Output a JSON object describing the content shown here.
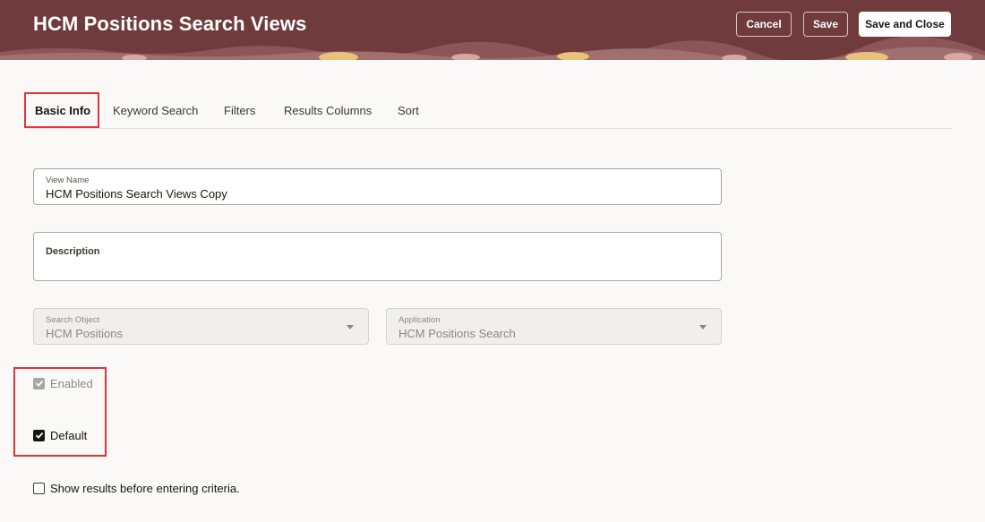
{
  "header": {
    "title": "HCM Positions Search Views",
    "cancel_label": "Cancel",
    "save_label": "Save",
    "save_close_label": "Save and Close"
  },
  "tabs": [
    {
      "label": "Basic Info",
      "active": true
    },
    {
      "label": "Keyword Search"
    },
    {
      "label": "Filters"
    },
    {
      "label": "Results Columns"
    },
    {
      "label": "Sort"
    }
  ],
  "form": {
    "view_name": {
      "label": "View Name",
      "value": "HCM Positions Search Views Copy"
    },
    "description": {
      "label": "Description",
      "value": ""
    },
    "search_object": {
      "label": "Search Object",
      "value": "HCM Positions"
    },
    "application": {
      "label": "Application",
      "value": "HCM Positions Search"
    },
    "enabled": {
      "label": "Enabled",
      "checked": true,
      "disabled": true
    },
    "default": {
      "label": "Default",
      "checked": true
    },
    "show_results": {
      "label": "Show results before entering criteria.",
      "checked": false
    }
  },
  "colors": {
    "header_bg": "#6f3b3d",
    "highlight": "#e2333b",
    "page_bg": "#faf9f7"
  },
  "icons": {
    "dropdown": "chevron-down-icon",
    "check": "checkmark-icon"
  }
}
